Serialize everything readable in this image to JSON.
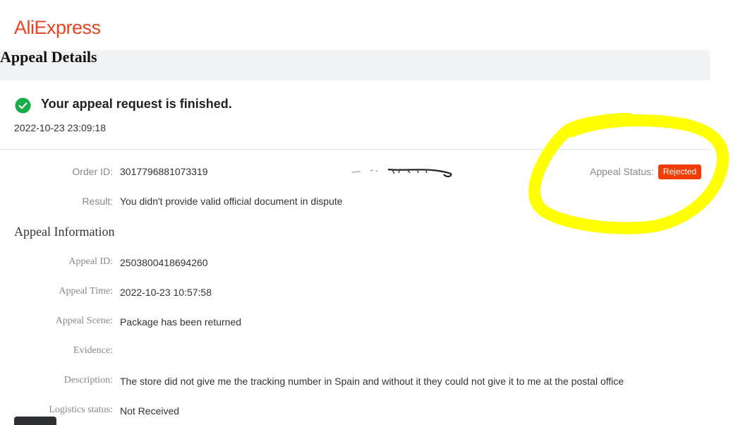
{
  "header": {
    "logo_text": "AliExpress",
    "page_title": "Appeal Details"
  },
  "result_banner": {
    "title": "Your appeal request is finished.",
    "timestamp": "2022-10-23 23:09:18",
    "icon": "check-circle-icon"
  },
  "order": {
    "order_id_label": "Order ID:",
    "order_id": "3017796881073319",
    "status_label": "Appeal Status:",
    "status": "Rejected",
    "result_label": "Result:",
    "result": "You didn't provide valid official document in dispute"
  },
  "appeal_info": {
    "section_title": "Appeal Information",
    "appeal_id_label": "Appeal ID:",
    "appeal_id": "2503800418694260",
    "appeal_time_label": "Appeal Time:",
    "appeal_time": "2022-10-23 10:57:58",
    "appeal_scene_label": "Appeal Scene:",
    "appeal_scene": "Package has been returned",
    "evidence_label": "Evidence:",
    "evidence": "",
    "description_label": "Description:",
    "description": "The store did not give me the tracking number in Spain and without it they could not give it to me at the postal office",
    "logistics_label": "Logistics status:",
    "logistics": "Not Received"
  },
  "colors": {
    "brand": "#e8441f",
    "status_badge": "#f23c06",
    "success": "#1aab4b",
    "annotation": "#ffff00"
  }
}
